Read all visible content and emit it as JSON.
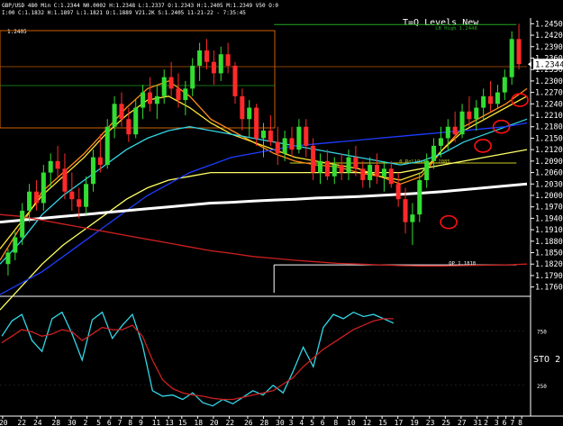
{
  "header": {
    "symbol_line": "GBP/USD 480 Min  C:1.2344  N0.0002  H:1.2348  L:1.2337  O:1.2343  H:1.2405  M:1.2349  V50  O:0",
    "ohlc_line": "I:00  C:1.1832  H:1.1897  L:1.1821  O:1.1889  V21.2K  S:1.2405  11-21-22 - 7:35:45",
    "corner_value": "1.2405"
  },
  "chart_title": "T=Q Levels New",
  "chart_data": [
    {
      "type": "candlestick",
      "title": "T=Q Levels New",
      "ylim": [
        1.1745,
        1.2465
      ],
      "y_tick_labels": [
        "1.2450",
        "1.2420",
        "1.2390",
        "1.2360",
        "1.2330",
        "1.2300",
        "1.2270",
        "1.2240",
        "1.2210",
        "1.2180",
        "1.2150",
        "1.2120",
        "1.2090",
        "1.2060",
        "1.2030",
        "1.2000",
        "1.1970",
        "1.1940",
        "1.1910",
        "1.1880",
        "1.1850",
        "1.1820",
        "1.1790",
        "1.1760"
      ],
      "y_tick_values": [
        1.245,
        1.242,
        1.239,
        1.236,
        1.233,
        1.23,
        1.227,
        1.224,
        1.221,
        1.218,
        1.215,
        1.212,
        1.209,
        1.206,
        1.203,
        1.2,
        1.197,
        1.194,
        1.191,
        1.188,
        1.185,
        1.182,
        1.179,
        1.176
      ],
      "last_price_label": "1.2344",
      "last_price": 1.2344,
      "x_tick_labels": [
        "20",
        "22",
        "24",
        "28",
        "30",
        "2",
        "5",
        "6",
        "7",
        "8",
        "9",
        "11",
        "13",
        "15",
        "18",
        "20",
        "22",
        "26",
        "28",
        "30",
        "3",
        "4",
        "5",
        "6",
        "8",
        "10",
        "12",
        "15",
        "17",
        "19",
        "23",
        "25",
        "27",
        "31",
        "2",
        "3",
        "6",
        "7",
        "8"
      ],
      "x_tick_fractions": [
        0.005,
        0.04,
        0.07,
        0.105,
        0.135,
        0.165,
        0.19,
        0.21,
        0.23,
        0.25,
        0.27,
        0.295,
        0.32,
        0.345,
        0.375,
        0.405,
        0.435,
        0.47,
        0.5,
        0.53,
        0.555,
        0.575,
        0.595,
        0.615,
        0.64,
        0.665,
        0.695,
        0.725,
        0.755,
        0.785,
        0.815,
        0.845,
        0.875,
        0.905,
        0.925,
        0.945,
        0.96,
        0.975,
        0.99
      ],
      "levels": [
        {
          "label": "LB High 1.2448",
          "value": 1.2448,
          "color": "#22aa22",
          "from": 0.52,
          "to": 0.98
        },
        {
          "label": "0 RollOver 1.2085",
          "value": 1.2085,
          "color": "#cccc22",
          "from": 0.55,
          "to": 0.98
        },
        {
          "label": "OP 1.1818",
          "value": 1.1818,
          "color": "#ffffff",
          "from": 0.52,
          "to": 0.98
        }
      ],
      "candles": [
        [
          1.182,
          1.186,
          1.179,
          1.185
        ],
        [
          1.185,
          1.1905,
          1.183,
          1.189
        ],
        [
          1.189,
          1.198,
          1.187,
          1.196
        ],
        [
          1.196,
          1.203,
          1.193,
          1.201
        ],
        [
          1.201,
          1.204,
          1.196,
          1.198
        ],
        [
          1.198,
          1.208,
          1.196,
          1.206
        ],
        [
          1.206,
          1.211,
          1.202,
          1.209
        ],
        [
          1.209,
          1.213,
          1.205,
          1.207
        ],
        [
          1.207,
          1.211,
          1.199,
          1.201
        ],
        [
          1.201,
          1.206,
          1.196,
          1.199
        ],
        [
          1.199,
          1.202,
          1.194,
          1.197
        ],
        [
          1.197,
          1.205,
          1.195,
          1.203
        ],
        [
          1.203,
          1.212,
          1.201,
          1.21
        ],
        [
          1.21,
          1.216,
          1.206,
          1.208
        ],
        [
          1.208,
          1.22,
          1.207,
          1.218
        ],
        [
          1.218,
          1.226,
          1.215,
          1.224
        ],
        [
          1.224,
          1.227,
          1.218,
          1.22
        ],
        [
          1.22,
          1.223,
          1.214,
          1.216
        ],
        [
          1.216,
          1.225,
          1.215,
          1.223
        ],
        [
          1.223,
          1.229,
          1.22,
          1.227
        ],
        [
          1.227,
          1.231,
          1.222,
          1.224
        ],
        [
          1.224,
          1.229,
          1.22,
          1.226
        ],
        [
          1.226,
          1.233,
          1.224,
          1.231
        ],
        [
          1.231,
          1.235,
          1.226,
          1.228
        ],
        [
          1.228,
          1.232,
          1.223,
          1.225
        ],
        [
          1.225,
          1.23,
          1.221,
          1.228
        ],
        [
          1.228,
          1.236,
          1.226,
          1.234
        ],
        [
          1.234,
          1.24,
          1.23,
          1.238
        ],
        [
          1.238,
          1.241,
          1.233,
          1.235
        ],
        [
          1.235,
          1.238,
          1.229,
          1.232
        ],
        [
          1.232,
          1.239,
          1.23,
          1.237
        ],
        [
          1.237,
          1.24,
          1.232,
          1.234
        ],
        [
          1.234,
          1.235,
          1.224,
          1.226
        ],
        [
          1.226,
          1.228,
          1.217,
          1.22
        ],
        [
          1.22,
          1.225,
          1.215,
          1.223
        ],
        [
          1.223,
          1.224,
          1.213,
          1.215
        ],
        [
          1.215,
          1.219,
          1.21,
          1.217
        ],
        [
          1.217,
          1.221,
          1.213,
          1.214
        ],
        [
          1.214,
          1.218,
          1.208,
          1.211
        ],
        [
          1.211,
          1.217,
          1.209,
          1.215
        ],
        [
          1.215,
          1.218,
          1.21,
          1.212
        ],
        [
          1.212,
          1.22,
          1.211,
          1.218
        ],
        [
          1.218,
          1.22,
          1.21,
          1.213
        ],
        [
          1.213,
          1.215,
          1.204,
          1.206
        ],
        [
          1.206,
          1.211,
          1.203,
          1.209
        ],
        [
          1.209,
          1.212,
          1.204,
          1.205
        ],
        [
          1.205,
          1.21,
          1.203,
          1.208
        ],
        [
          1.208,
          1.211,
          1.204,
          1.206
        ],
        [
          1.206,
          1.212,
          1.204,
          1.21
        ],
        [
          1.21,
          1.213,
          1.205,
          1.207
        ],
        [
          1.207,
          1.209,
          1.202,
          1.204
        ],
        [
          1.204,
          1.21,
          1.202,
          1.208
        ],
        [
          1.208,
          1.211,
          1.203,
          1.205
        ],
        [
          1.205,
          1.209,
          1.201,
          1.207
        ],
        [
          1.207,
          1.209,
          1.202,
          1.203
        ],
        [
          1.203,
          1.206,
          1.197,
          1.199
        ],
        [
          1.199,
          1.202,
          1.19,
          1.193
        ],
        [
          1.193,
          1.198,
          1.187,
          1.195
        ],
        [
          1.195,
          1.206,
          1.193,
          1.204
        ],
        [
          1.204,
          1.211,
          1.202,
          1.209
        ],
        [
          1.209,
          1.215,
          1.207,
          1.213
        ],
        [
          1.213,
          1.218,
          1.21,
          1.215
        ],
        [
          1.215,
          1.22,
          1.212,
          1.218
        ],
        [
          1.218,
          1.222,
          1.214,
          1.216
        ],
        [
          1.216,
          1.224,
          1.215,
          1.222
        ],
        [
          1.222,
          1.226,
          1.218,
          1.22
        ],
        [
          1.22,
          1.225,
          1.217,
          1.223
        ],
        [
          1.223,
          1.228,
          1.22,
          1.226
        ],
        [
          1.226,
          1.23,
          1.222,
          1.224
        ],
        [
          1.224,
          1.229,
          1.223,
          1.227
        ],
        [
          1.227,
          1.233,
          1.225,
          1.231
        ],
        [
          1.231,
          1.243,
          1.229,
          1.241
        ],
        [
          1.241,
          1.245,
          1.233,
          1.2344
        ]
      ],
      "moving_averages": [
        {
          "color": "#ff8c1a",
          "values": [
            1.183,
            1.192,
            1.201,
            1.206,
            1.211,
            1.217,
            1.223,
            1.228,
            1.23,
            1.226,
            1.22,
            1.217,
            1.214,
            1.211,
            1.209,
            1.208,
            1.2075,
            1.206,
            1.205,
            1.203,
            1.205,
            1.212,
            1.218,
            1.221,
            1.224,
            1.228
          ]
        },
        {
          "color": "#ffe633",
          "values": [
            1.186,
            1.193,
            1.2,
            1.205,
            1.21,
            1.216,
            1.221,
            1.225,
            1.226,
            1.223,
            1.219,
            1.216,
            1.214,
            1.212,
            1.21,
            1.209,
            1.208,
            1.207,
            1.205,
            1.204,
            1.206,
            1.212,
            1.217,
            1.22,
            1.223,
            1.226
          ]
        },
        {
          "color": "#33d6e6",
          "values": [
            1.182,
            1.188,
            1.195,
            1.2,
            1.204,
            1.208,
            1.212,
            1.215,
            1.217,
            1.218,
            1.217,
            1.216,
            1.215,
            1.214,
            1.213,
            1.212,
            1.211,
            1.21,
            1.209,
            1.208,
            1.209,
            1.211,
            1.214,
            1.216,
            1.218,
            1.22
          ]
        },
        {
          "color": "#ffff66",
          "values": [
            1.17,
            1.176,
            1.182,
            1.187,
            1.191,
            1.195,
            1.199,
            1.202,
            1.204,
            1.205,
            1.206,
            1.206,
            1.206,
            1.206,
            1.206,
            1.206,
            1.206,
            1.206,
            1.206,
            1.206,
            1.207,
            1.208,
            1.209,
            1.21,
            1.211,
            1.212
          ]
        },
        {
          "color": "#1e3cff",
          "values": [
            1.174,
            1.177,
            1.18,
            1.184,
            1.188,
            1.192,
            1.196,
            1.2,
            1.203,
            1.206,
            1.208,
            1.21,
            1.211,
            1.212,
            1.213,
            1.2135,
            1.214,
            1.2145,
            1.215,
            1.2155,
            1.216,
            1.2165,
            1.217,
            1.2175,
            1.218,
            1.219
          ]
        },
        {
          "color": "#ffffff",
          "values": [
            1.193,
            1.1935,
            1.194,
            1.1945,
            1.195,
            1.1955,
            1.196,
            1.1965,
            1.197,
            1.1975,
            1.198,
            1.1982,
            1.1985,
            1.1988,
            1.199,
            1.1993,
            1.1995,
            1.1997,
            1.2,
            1.2003,
            1.2006,
            1.201,
            1.2015,
            1.202,
            1.2025,
            1.203
          ]
        },
        {
          "color": "#cc2020",
          "values": [
            1.195,
            1.1945,
            1.1935,
            1.1925,
            1.1915,
            1.1905,
            1.1895,
            1.1885,
            1.1875,
            1.1865,
            1.1855,
            1.1848,
            1.184,
            1.1835,
            1.183,
            1.1826,
            1.1822,
            1.182,
            1.1818,
            1.1816,
            1.1815,
            1.1815,
            1.1816,
            1.1817,
            1.1818,
            1.182
          ]
        }
      ],
      "circles": [
        [
          0.86,
          1.193
        ],
        [
          0.925,
          1.213
        ],
        [
          0.96,
          1.218
        ],
        [
          0.995,
          1.225
        ]
      ]
    },
    {
      "type": "line",
      "title": "STO 2",
      "ylim": [
        0,
        1000
      ],
      "y_tick_labels": [
        "250",
        "750"
      ],
      "y_tick_values": [
        250,
        750
      ],
      "label_box": "STO  2",
      "series": [
        {
          "color": "#33d6e6",
          "values": [
            700,
            840,
            900,
            660,
            560,
            860,
            920,
            720,
            480,
            850,
            920,
            680,
            800,
            900,
            620,
            200,
            150,
            160,
            120,
            180,
            90,
            60,
            120,
            80,
            140,
            200,
            160,
            250,
            180,
            380,
            600,
            420,
            780,
            900,
            860,
            920,
            880,
            900,
            860,
            820
          ]
        },
        {
          "color": "#cc2020",
          "values": [
            640,
            700,
            760,
            740,
            700,
            720,
            760,
            740,
            660,
            720,
            780,
            760,
            760,
            800,
            700,
            480,
            300,
            220,
            180,
            160,
            150,
            130,
            120,
            120,
            140,
            160,
            180,
            200,
            260,
            320,
            420,
            500,
            580,
            640,
            700,
            760,
            800,
            840,
            860,
            860
          ]
        }
      ]
    }
  ]
}
